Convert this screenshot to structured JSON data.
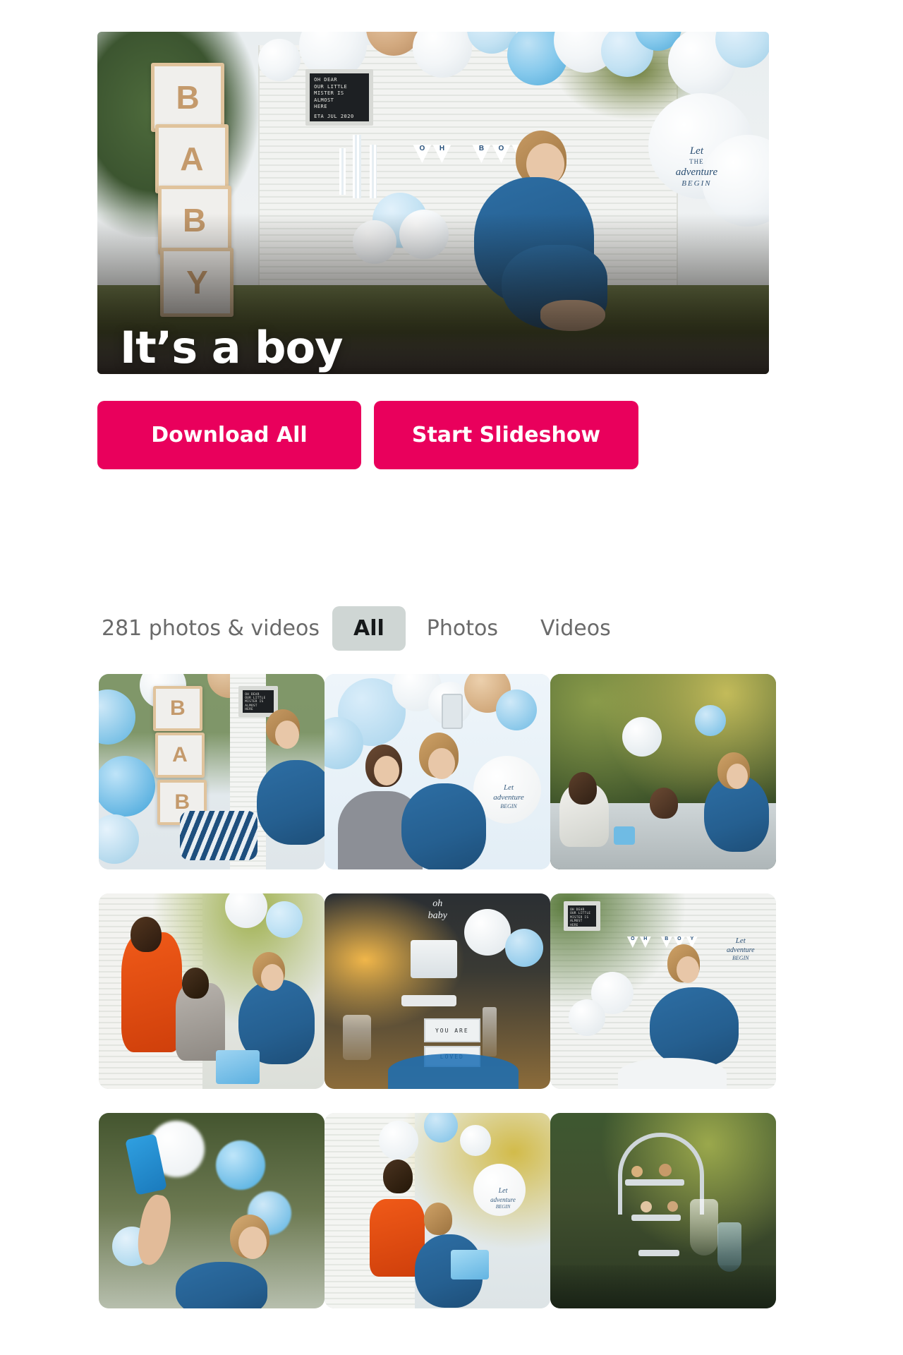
{
  "hero": {
    "title": "It’s a boy",
    "alt": "Pregnant woman in blue dress sitting in front of BABY blocks and balloon arch"
  },
  "actions": {
    "download_label": "Download All",
    "slideshow_label": "Start Slideshow",
    "accent_color": "#E9005C"
  },
  "gallery": {
    "count_label": "281 photos & videos",
    "count": 281,
    "tabs": [
      {
        "label": "All",
        "active": true
      },
      {
        "label": "Photos",
        "active": false
      },
      {
        "label": "Videos",
        "active": false
      }
    ],
    "active_tab_bg": "#cfd6d4",
    "thumbnails": [
      {
        "alt": "BABY blocks with woman laughing holding confetti popper"
      },
      {
        "alt": "Two women taking a selfie in front of balloon arch"
      },
      {
        "alt": "Guests seated at garden table with balloons"
      },
      {
        "alt": "Women opening gifts at baby shower"
      },
      {
        "alt": "Oh baby cake on dessert table with YOU ARE LOVED LIL ONE sign"
      },
      {
        "alt": "Pregnant woman kneeling in front of OH BOY banner"
      },
      {
        "alt": "Woman holding blue phone taking a selfie"
      },
      {
        "alt": "Group of women gathered around gift table"
      },
      {
        "alt": "Tiered dessert stand with pastries"
      }
    ]
  }
}
